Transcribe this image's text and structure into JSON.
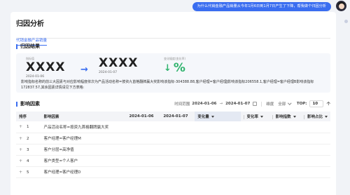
{
  "chat": {
    "question": "为什么代销金融产品销量从今年1月6日到1月7日产生了下降，帮我做个归因分析"
  },
  "header": {
    "title": "归因分析",
    "tab": "代销金融产品销量"
  },
  "result": {
    "title": "归因结果",
    "before": {
      "label": "指标值",
      "value": "XXXX",
      "date": "2024-01-06"
    },
    "after": {
      "label": "",
      "value": "XXXX",
      "date": "2024-01-07"
    },
    "change": {
      "label": "变化幅度(变化率)",
      "value": "%"
    },
    "description": "影响指标名称的前三大因素与对应影响幅度依次为产品活动名称=按资九首格翻牌赢大奖影响该指标-304388.88,客户经理=客户经理J影响该指标206558.1,客户经理=客户经理B影响该指标172837.57,其余因素详情请见下方表格:"
  },
  "factors": {
    "title": "影响因素",
    "time_label": "时间范围",
    "date_start": "2024-01-06",
    "date_sep": "→",
    "date_end": "2024-01-07",
    "dim_label": "维度",
    "dim_placeholder": "全部",
    "top_label": "TOP:",
    "top_value": "10",
    "top_unit": "个"
  },
  "table": {
    "headers": [
      "排序",
      "影响因素",
      "2024-01-06",
      "2024-01-07",
      "变化量",
      "变化率",
      "影响指数",
      "影响占比"
    ],
    "rows": [
      {
        "rank": "1",
        "factor": "产品活动名称=按资九首格翻牌赢大奖"
      },
      {
        "rank": "2",
        "factor": "客户经理=客户经理M"
      },
      {
        "rank": "3",
        "factor": "客户分层=高净值"
      },
      {
        "rank": "4",
        "factor": "客户类型=个人客户"
      },
      {
        "rank": "5",
        "factor": "客户经理=客户经理D"
      }
    ]
  },
  "colors": {
    "accent": "#3a6df0",
    "positive": "#2fb36d"
  }
}
